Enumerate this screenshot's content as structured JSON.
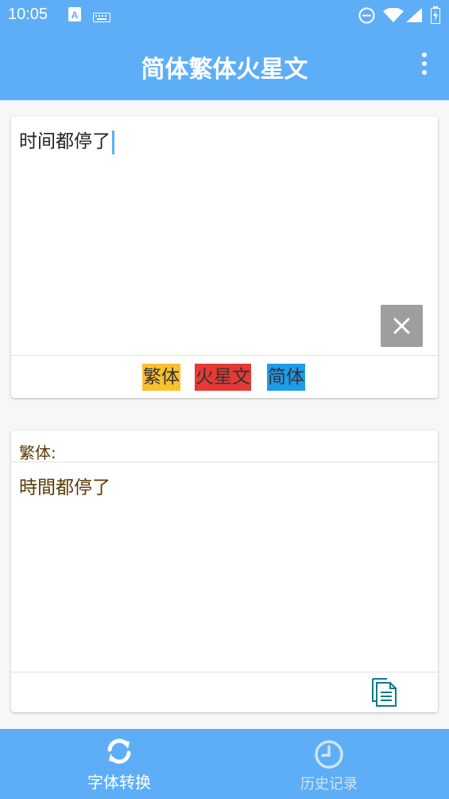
{
  "status_bar": {
    "time": "10:05",
    "icons": [
      "a-notification-icon",
      "keyboard-icon",
      "do-not-disturb-icon",
      "wifi-icon",
      "signal-icon",
      "battery-charging-icon"
    ]
  },
  "app_bar": {
    "title": "简体繁体火星文",
    "menu_icon": "more-vert-icon"
  },
  "input_card": {
    "text": "时间都停了",
    "clear_icon": "close-icon",
    "buttons": [
      {
        "label": "繁体",
        "color": "#fbc02d"
      },
      {
        "label": "火星文",
        "color": "#e53935"
      },
      {
        "label": "简体",
        "color": "#1e9bea"
      }
    ]
  },
  "output_card": {
    "label": "繁体:",
    "text": "時間都停了",
    "copy_icon": "copy-document-icon",
    "text_color": "#5b3a06"
  },
  "bottom_nav": {
    "items": [
      {
        "label": "字体转换",
        "icon": "sync-icon",
        "active": true
      },
      {
        "label": "历史记录",
        "icon": "clock-icon",
        "active": false
      }
    ]
  },
  "colors": {
    "primary": "#5eaef7",
    "clear_button": "#9e9e9e",
    "copy_icon": "#0d7a86"
  }
}
